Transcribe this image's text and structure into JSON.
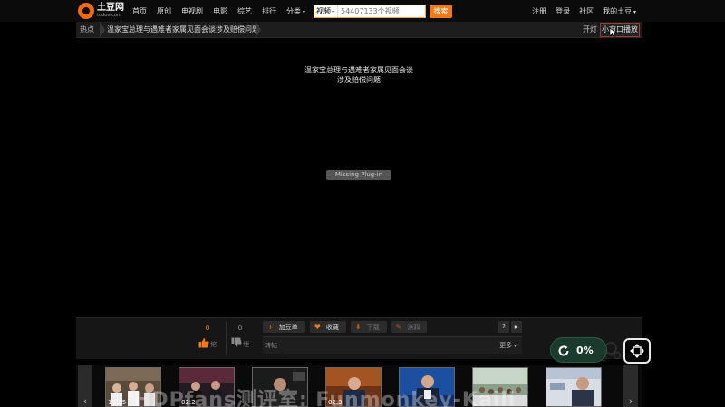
{
  "site": {
    "logo_text": "土豆网",
    "logo_sub": "tudou.com",
    "brand_color": "#f06a0f"
  },
  "nav": {
    "items": [
      "首页",
      "原创",
      "电视剧",
      "电影",
      "综艺",
      "排行",
      "分类"
    ],
    "search_category": "视频",
    "search_placeholder": "54407133个视频",
    "search_button": "搜索",
    "user_links": [
      "注册",
      "登录",
      "社区",
      "我的土豆"
    ]
  },
  "crumb": {
    "hot": "热点",
    "title": "温家宝总理与遇难者家属见面会谈涉及赔偿问题",
    "light": "开灯",
    "popout": "小窗口播放"
  },
  "player": {
    "title_line1": "温家宝总理与遇难者家属见面会谈",
    "title_line2": "涉及赔偿问题",
    "plugin_text": "Missing Plug-in"
  },
  "controls": {
    "up_count": "0",
    "up_label": "挖",
    "down_count": "0",
    "down_label": "埋",
    "actions": [
      {
        "icon": "+",
        "label": "加豆单",
        "disabled": false
      },
      {
        "icon": "♥",
        "label": "收藏",
        "disabled": false
      },
      {
        "icon": "⬇",
        "label": "下载",
        "disabled": true
      },
      {
        "icon": "✎",
        "label": "涂鸦",
        "disabled": true
      }
    ],
    "help": "?",
    "next": "▶",
    "danmu_label": "转帖",
    "more": "更多"
  },
  "overlay": {
    "progress_percent": "0%",
    "progress_value": 0
  },
  "strip": {
    "prev": "‹",
    "next": "›",
    "thumbnails": [
      {
        "time": "11:05"
      },
      {
        "time": "02:2"
      },
      {
        "time": ""
      },
      {
        "time": "02:3"
      },
      {
        "time": ""
      },
      {
        "time": ""
      },
      {
        "time": ""
      }
    ],
    "watermark": "HDPfans测评室: Funmonkey-Kaili"
  }
}
